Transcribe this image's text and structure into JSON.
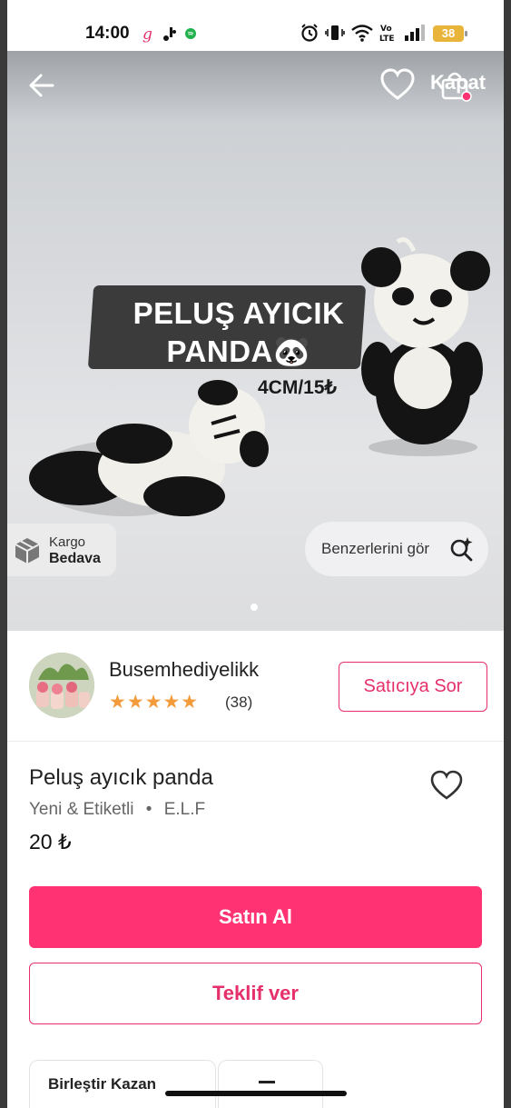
{
  "status_bar": {
    "time": "14:00",
    "battery": "38",
    "network": "Vo LTE",
    "icons": [
      "alarm-icon",
      "vibrate-icon",
      "wifi-icon",
      "signal-icon"
    ]
  },
  "top_bar": {
    "close_label": "Kapat",
    "icons": [
      "back-arrow-icon",
      "heart-icon",
      "shopping-bag-icon"
    ]
  },
  "image": {
    "sign_line1": "PELUŞ AYICIK",
    "sign_line2": "PANDA🐼",
    "price_tag": "4CM/15₺",
    "kargo_line1": "Kargo",
    "kargo_line2": "Bedava",
    "similar_label": "Benzerlerini gör",
    "carousel_index": 1,
    "carousel_count": 1
  },
  "seller": {
    "name": "Busemhediyelikk",
    "rating": 5,
    "stars": "★★★★★",
    "rating_count": "(38)",
    "ask_button": "Satıcıya Sor"
  },
  "product": {
    "title": "Peluş ayıcık panda",
    "condition": "Yeni & Etiketli",
    "brand": "E.L.F",
    "price": "20 ₺"
  },
  "actions": {
    "buy_label": "Satın Al",
    "offer_label": "Teklif ver"
  },
  "bottom_tabs": {
    "tab1_label": "Birleştir Kazan"
  },
  "colors": {
    "accent": "#ff3273",
    "star": "#f39b3b",
    "battery": "#e9b43a"
  }
}
